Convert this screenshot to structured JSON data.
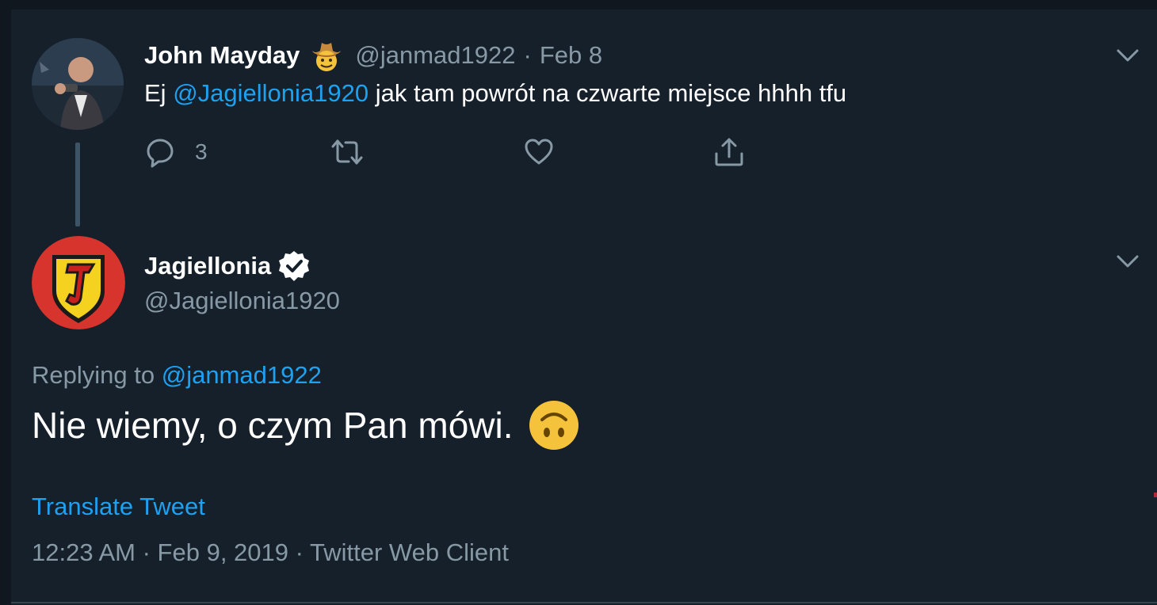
{
  "parent_tweet": {
    "author_name": "John Mayday",
    "author_emoji": "cowboy-hat-face-emoji",
    "handle": "@janmad1922",
    "separator": "·",
    "date": "Feb 8",
    "text_prefix": "Ej ",
    "mention": "@Jagiellonia1920",
    "text_suffix": " jak tam powrót na czwarte miejsce hhhh tfu",
    "reply_count": "3",
    "actions": [
      "reply-icon",
      "retweet-icon",
      "like-icon",
      "share-icon"
    ]
  },
  "reply_tweet": {
    "author_name": "Jagiellonia",
    "verified": true,
    "handle": "@Jagiellonia1920",
    "replying_to_label": "Replying to ",
    "replying_to_handle": "@janmad1922",
    "text": "Nie wiemy, o czym Pan mówi.",
    "emoji": "upside-down-face-emoji",
    "translate_label": "Translate Tweet",
    "time": "12:23 AM",
    "separator": " · ",
    "date": "Feb 9, 2019",
    "source": "Twitter Web Client"
  },
  "colors": {
    "background": "#15202b",
    "accent": "#1da1f2",
    "secondary_text": "#8899a6",
    "primary_text": "#ffffff"
  }
}
